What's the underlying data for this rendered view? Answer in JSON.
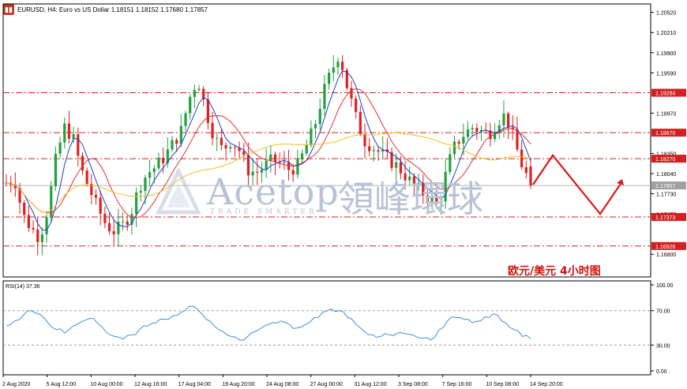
{
  "header": {
    "text": "EURUSD, H4:  Euro vs US Dollar  1.18151 1.18152 1.17680 1.17857"
  },
  "caption": "欧元/美元   4小时图",
  "watermark": {
    "brand": "Acetop",
    "brand_cn": "領峰環球",
    "tagline": "TRADE SMARTER"
  },
  "colors": {
    "bull": "#23a040",
    "bear": "#e02020",
    "ma_fast": "#1f3fd0",
    "ma_mid": "#e53030",
    "ma_slow": "#f0c020",
    "level": "#d42020",
    "rsi": "#3a8fe0",
    "arrow": "#e01818"
  },
  "chart_data": {
    "type": "candlestick",
    "symbol": "EURUSD",
    "timeframe": "H4",
    "ohlc_last": {
      "open": 1.18151,
      "high": 1.18152,
      "low": 1.1768,
      "close": 1.17857
    },
    "ylim": [
      1.1645,
      1.2065
    ],
    "y_ticks": [
      "1.20520",
      "1.20210",
      "1.19900",
      "1.19590",
      "1.18970",
      "1.18350",
      "1.18040",
      "1.17730",
      "1.17420",
      "1.16800"
    ],
    "x_ticks": [
      "2 Aug 2020",
      "5 Aug 12:00",
      "10 Aug 00:00",
      "12 Aug 16:00",
      "17 Aug 04:00",
      "19 Aug 20:00",
      "24 Aug 08:00",
      "27 Aug 00:00",
      "31 Aug 12:00",
      "3 Sep 08:00",
      "7 Sep 16:00",
      "10 Sep 08:00",
      "14 Sep 20:00"
    ],
    "levels": [
      {
        "value": 1.19284,
        "label": "1.19284"
      },
      {
        "value": 1.1867,
        "label": "1.18670"
      },
      {
        "value": 1.1827,
        "label": "1.18270"
      },
      {
        "value": 1.17373,
        "label": "1.17373"
      },
      {
        "value": 1.16926,
        "label": "1.16926"
      }
    ],
    "current_price": {
      "value": 1.17857,
      "label": "1.17857"
    },
    "close_path": [
      1.179,
      1.1795,
      1.174,
      1.172,
      1.1705,
      1.175,
      1.183,
      1.1875,
      1.186,
      1.181,
      1.178,
      1.175,
      1.1725,
      1.1715,
      1.1725,
      1.1745,
      1.1785,
      1.1805,
      1.1815,
      1.183,
      1.185,
      1.187,
      1.192,
      1.195,
      1.19,
      1.186,
      1.184,
      1.1855,
      1.184,
      1.181,
      1.1805,
      1.1815,
      1.1825,
      1.182,
      1.181,
      1.1815,
      1.1845,
      1.1875,
      1.1925,
      1.196,
      1.199,
      1.1935,
      1.189,
      1.1855,
      1.1845,
      1.1835,
      1.1825,
      1.1815,
      1.18,
      1.1785,
      1.1775,
      1.1765,
      1.1755,
      1.1815,
      1.185,
      1.1865,
      1.1875,
      1.187,
      1.1865,
      1.1885,
      1.1895,
      1.1855,
      1.1815,
      1.1787
    ],
    "projection": [
      1.1787,
      1.1832,
      1.1742,
      1.1792
    ],
    "rsi": {
      "label": "RSI(14) 37.36",
      "value": 37.36,
      "levels": [
        70,
        30
      ],
      "y_ticks": [
        "100.00",
        "70.00",
        "30.00",
        "0.00"
      ],
      "ylim": [
        0,
        100
      ],
      "path": [
        52,
        58,
        64,
        70,
        66,
        56,
        48,
        44,
        52,
        57,
        61,
        55,
        45,
        40,
        37,
        42,
        48,
        52,
        56,
        60,
        64,
        68,
        75,
        71,
        60,
        52,
        46,
        40,
        36,
        40,
        46,
        52,
        56,
        58,
        54,
        50,
        54,
        62,
        68,
        72,
        70,
        62,
        54,
        46,
        42,
        40,
        42,
        44,
        43,
        41,
        38,
        36,
        48,
        58,
        62,
        60,
        56,
        58,
        62,
        65,
        56,
        48,
        40,
        37.36
      ]
    }
  }
}
